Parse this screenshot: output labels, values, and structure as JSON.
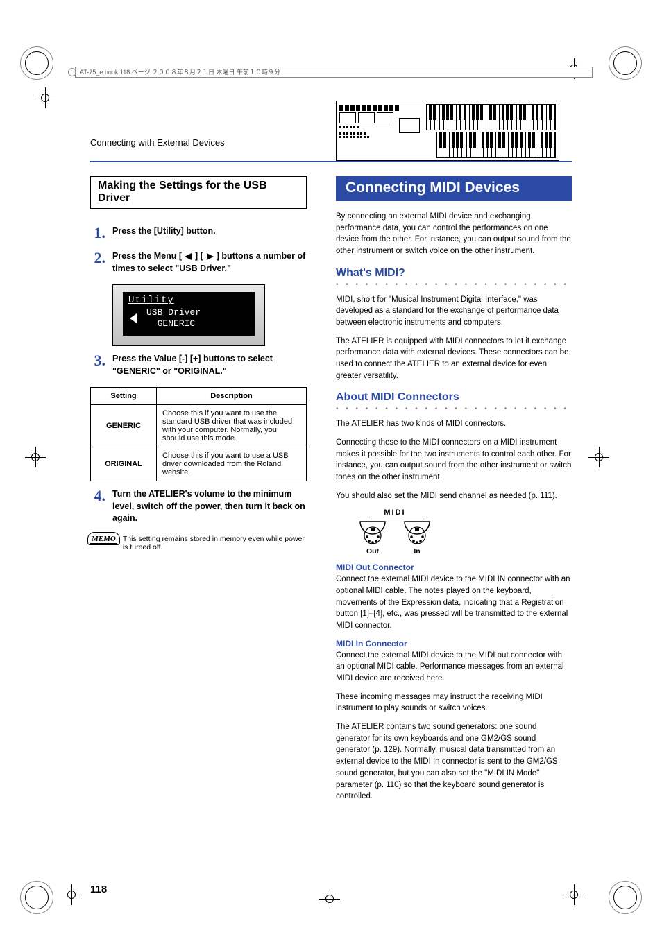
{
  "header_meta": "AT-75_e.book 118 ページ ２００８年８月２１日 木曜日 午前１０時９分",
  "breadcrumb": "Connecting with External Devices",
  "page_number": "118",
  "left": {
    "heading": "Making the Settings for the USB Driver",
    "steps": {
      "s1": "Press the [Utility] button.",
      "s2_a": "Press the Menu [",
      "s2_b": "] [",
      "s2_c": "] buttons a number of times to select \"USB Driver.\"",
      "s3": "Press the Value [-] [+] buttons to select \"GENERIC\" or \"ORIGINAL.\"",
      "s4": "Turn the ATELIER's volume to the minimum level, switch off the power, then turn it back on again."
    },
    "lcd": {
      "title": "Utility",
      "line1": "USB Driver",
      "line2": "  GENERIC"
    },
    "table": {
      "h1": "Setting",
      "h2": "Description",
      "r1name": "GENERIC",
      "r1desc": "Choose this if you want to use the standard USB driver that was included with your computer.\nNormally, you should use this mode.",
      "r2name": "ORIGINAL",
      "r2desc": "Choose this if you want to use a USB driver downloaded from the Roland website."
    },
    "memo_label": "MEMO",
    "memo_text": "This setting remains stored in memory even while power is turned off."
  },
  "right": {
    "banner": "Connecting MIDI Devices",
    "intro": "By connecting an external MIDI device and exchanging performance data, you can control the performances on one device from the other. For instance, you can output sound from the other instrument or switch voice on the other instrument.",
    "whats_midi_h": "What's MIDI?",
    "whats_midi_p1": "MIDI, short for \"Musical Instrument Digital Interface,\" was developed as a standard for the exchange of performance data between electronic instruments and computers.",
    "whats_midi_p2": "The ATELIER is equipped with MIDI connectors to let it exchange performance data with external devices. These connectors can be used to connect the ATELIER to an external device for even greater versatility.",
    "about_h": "About MIDI Connectors",
    "about_p1": "The ATELIER has two kinds of MIDI connectors.",
    "about_p2": "Connecting these to the MIDI connectors on a MIDI instrument makes it possible for the two instruments to control each other. For instance, you can output sound from the other instrument or switch tones on the other instrument.",
    "about_p3": "You should also set the MIDI send channel as needed (p. 111).",
    "midi_label": "MIDI",
    "out_label": "Out",
    "in_label": "In",
    "midi_out_h": "MIDI Out Connector",
    "midi_out_p": "Connect the external MIDI device to the MIDI IN connector with an optional MIDI cable. The notes played on the keyboard, movements of the Expression data, indicating that a Registration button [1]–[4], etc., was pressed will be transmitted to the external MIDI connector.",
    "midi_in_h": "MIDI In Connector",
    "midi_in_p1": "Connect the external MIDI device to the MIDI out connector with an optional MIDI cable. Performance messages from an external MIDI device are received here.",
    "midi_in_p2": "These incoming messages may instruct the receiving MIDI instrument to play sounds or switch voices.",
    "midi_in_p3": "The ATELIER contains two sound generators: one sound generator for its own keyboards and one GM2/GS sound generator (p. 129). Normally, musical data transmitted from an external device to the MIDI In connector is sent to the GM2/GS sound generator, but you can also set the \"MIDI IN Mode\" parameter (p. 110) so that the keyboard sound generator is controlled."
  }
}
